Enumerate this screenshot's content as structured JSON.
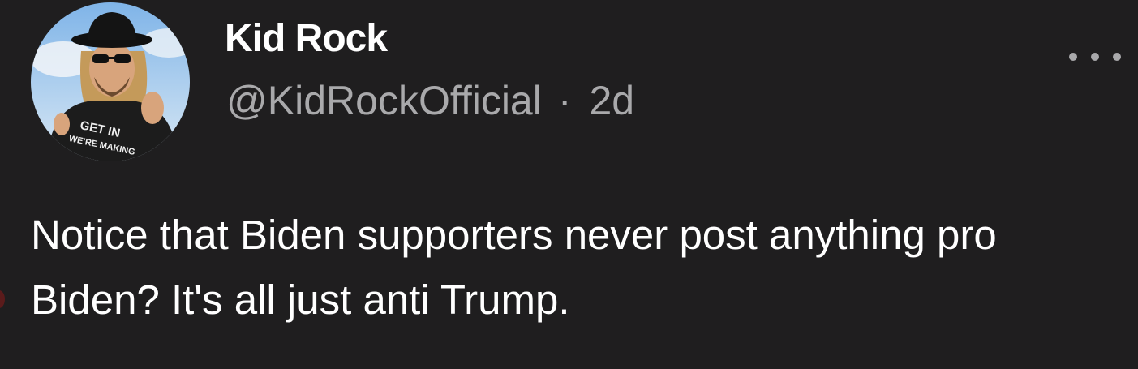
{
  "tweet": {
    "display_name": "Kid Rock",
    "handle": "@KidRockOfficial",
    "separator": "·",
    "time_ago": "2d",
    "text": "Notice that Biden supporters never post anything pro Biden? It's all just anti Trump.",
    "avatar_shirt_text": [
      "GET IN",
      "WE'RE MAKING"
    ],
    "more_icon": "more-horizontal-icon"
  },
  "colors": {
    "background": "#1f1e1f",
    "primary_text": "#ffffff",
    "secondary_text": "#a9a9ab"
  }
}
